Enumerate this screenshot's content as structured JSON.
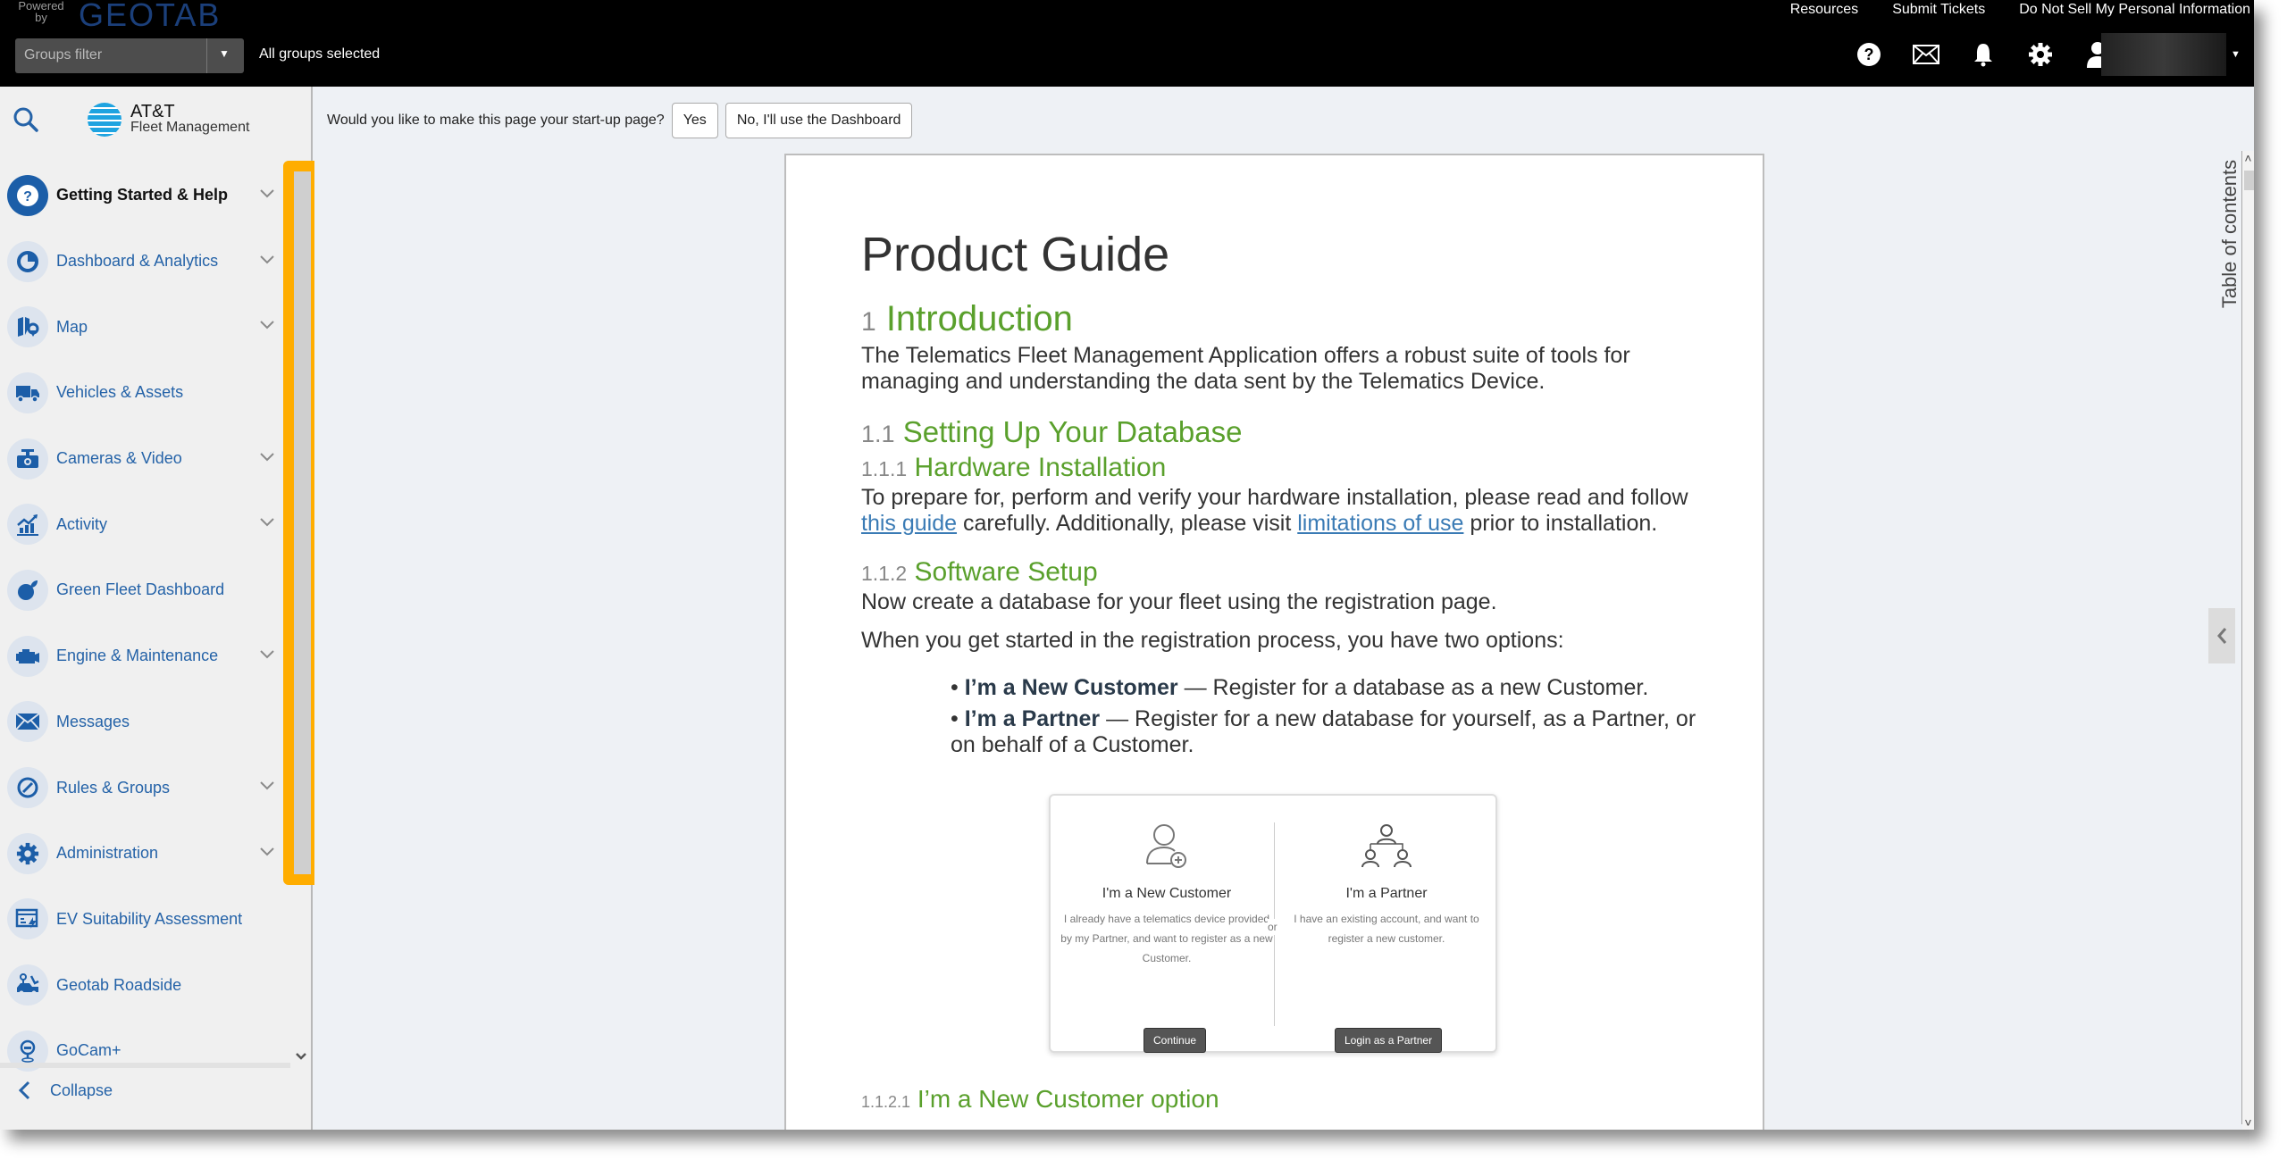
{
  "topbar": {
    "powered_by": "Powered by",
    "brand": "GEOTAB",
    "groups_filter_placeholder": "Groups filter",
    "groups_selected": "All groups selected",
    "links": [
      "Resources",
      "Submit Tickets",
      "Do Not Sell My Personal Information"
    ],
    "icons": [
      "help-icon",
      "mail-icon",
      "bell-icon",
      "gear-icon",
      "user-icon"
    ]
  },
  "sidebar": {
    "brand_line1": "AT&T",
    "brand_line2": "Fleet Management",
    "items": [
      {
        "label": "Getting Started & Help",
        "icon": "help-icon",
        "expandable": true,
        "active": true
      },
      {
        "label": "Dashboard & Analytics",
        "icon": "pie-chart-icon",
        "expandable": true
      },
      {
        "label": "Map",
        "icon": "map-icon",
        "expandable": true
      },
      {
        "label": "Vehicles & Assets",
        "icon": "truck-icon",
        "expandable": false
      },
      {
        "label": "Cameras & Video",
        "icon": "camera-icon",
        "expandable": true
      },
      {
        "label": "Activity",
        "icon": "activity-chart-icon",
        "expandable": true
      },
      {
        "label": "Green Fleet Dashboard",
        "icon": "leaf-icon",
        "expandable": false
      },
      {
        "label": "Engine & Maintenance",
        "icon": "engine-icon",
        "expandable": true
      },
      {
        "label": "Messages",
        "icon": "envelope-icon",
        "expandable": false
      },
      {
        "label": "Rules & Groups",
        "icon": "rules-icon",
        "expandable": true
      },
      {
        "label": "Administration",
        "icon": "gear-icon",
        "expandable": true
      },
      {
        "label": "EV Suitability Assessment",
        "icon": "ev-icon",
        "expandable": false
      },
      {
        "label": "Geotab Roadside",
        "icon": "tow-truck-icon",
        "expandable": false
      },
      {
        "label": "GoCam+",
        "icon": "gocam-icon",
        "expandable": false
      }
    ],
    "collapse_label": "Collapse"
  },
  "startup_prompt": {
    "question": "Would you like to make this page your start-up page?",
    "yes_label": "Yes",
    "no_label": "No, I'll use the Dashboard"
  },
  "document": {
    "title": "Product Guide",
    "s1_num": "1",
    "s1_title": "Introduction",
    "s1_text": "The Telematics Fleet Management Application offers a robust suite of tools for managing and understanding the data sent by the Telematics Device.",
    "s11_num": "1.1",
    "s11_title": "Setting Up Your Database",
    "s111_num": "1.1.1",
    "s111_title": "Hardware Installation",
    "s111_text_a": "To prepare for, perform and verify your hardware installation, please read and follow ",
    "s111_link1": "this guide",
    "s111_text_b": " carefully. Additionally, please visit ",
    "s111_link2": "limitations of use",
    "s111_text_c": " prior to installation.",
    "s112_num": "1.1.2",
    "s112_title": "Software Setup",
    "s112_text1": "Now create a database for your fleet using the registration page.",
    "s112_text2": "When you get started in the registration process, you have two options:",
    "bullets": [
      {
        "bold": "I’m a New Customer",
        "text": " — Register for a database as a new Customer."
      },
      {
        "bold": "I’m a Partner",
        "text": " — Register for a new database for yourself, as a Partner, or on behalf of a Customer."
      }
    ],
    "reg_card": {
      "left_title": "I'm a New Customer",
      "left_desc": "I already have a telematics device provided by my Partner, and want to register as a new Customer.",
      "left_button": "Continue",
      "or": "or",
      "right_title": "I'm a Partner",
      "right_desc": "I have an existing account, and want to register a new customer.",
      "right_button": "Login as a Partner"
    },
    "s1121_num": "1.1.2.1",
    "s1121_title": "I’m a New Customer option"
  },
  "toc_label": "Table of contents",
  "colors": {
    "accent_blue": "#2563a8",
    "heading_green": "#5aa02c",
    "highlight_orange": "#ffad00"
  }
}
